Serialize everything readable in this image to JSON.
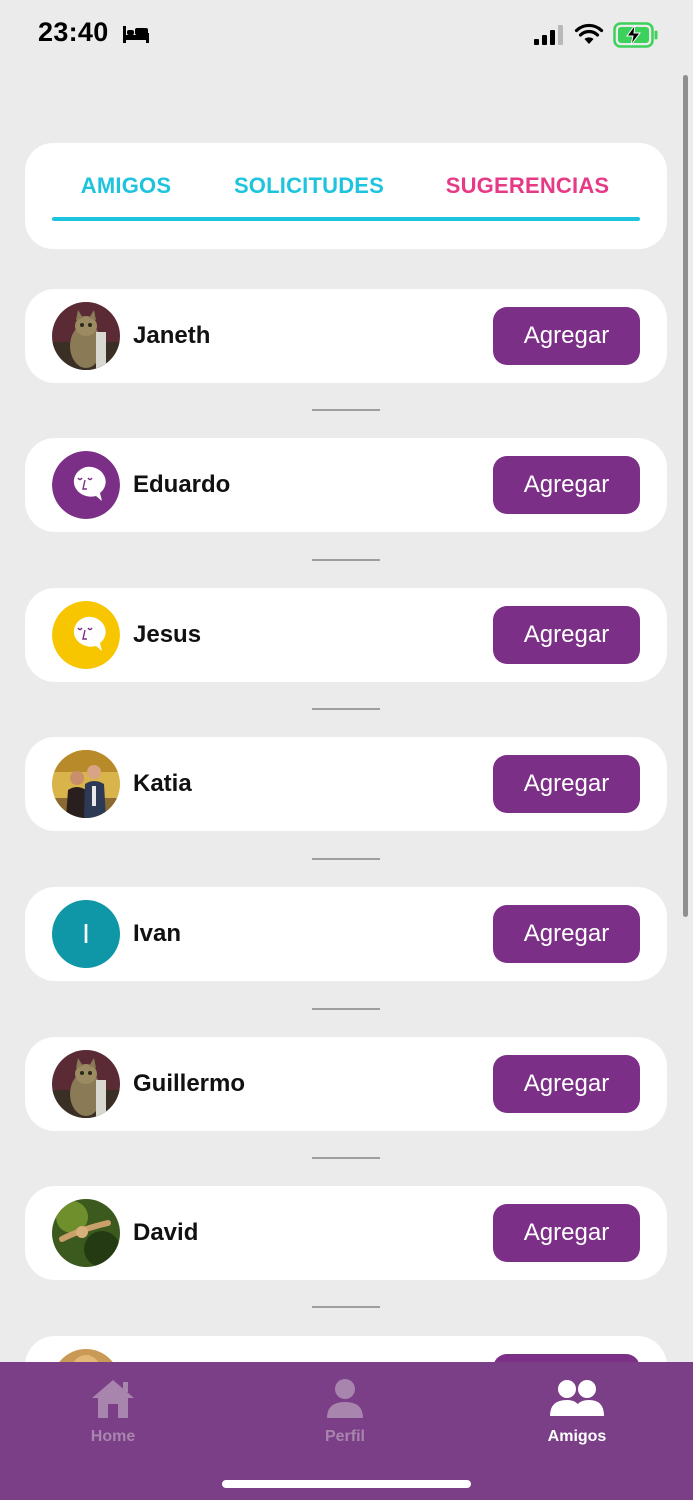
{
  "status_bar": {
    "time": "23:40",
    "icons": [
      "bed-icon",
      "cellular-signal-icon",
      "wifi-icon",
      "battery-charging-icon"
    ],
    "battery_color": "#3cd15b"
  },
  "tabs": [
    {
      "label": "AMIGOS",
      "color": "#1ec4dd"
    },
    {
      "label": "SOLICITUDES",
      "color": "#1ec4dd"
    },
    {
      "label": "SUGERENCIAS",
      "color": "#e73a86",
      "active": true
    }
  ],
  "colors": {
    "accent_cyan": "#1ec4dd",
    "accent_pink": "#e73a86",
    "button_purple": "#7b2f86",
    "nav_purple": "#7b3f88",
    "background": "#ebebeb"
  },
  "people": [
    {
      "name": "Janeth",
      "avatar": "cat-photo",
      "button": "Agregar"
    },
    {
      "name": "Eduardo",
      "avatar": "purple-chat-bubble",
      "button": "Agregar"
    },
    {
      "name": "Jesus",
      "avatar": "yellow-chat-bubble",
      "button": "Agregar"
    },
    {
      "name": "Katia",
      "avatar": "couple-photo",
      "button": "Agregar"
    },
    {
      "name": "Ivan",
      "avatar": "initial",
      "avatar_letter": "I",
      "button": "Agregar"
    },
    {
      "name": "Guillermo",
      "avatar": "cat-photo",
      "button": "Agregar"
    },
    {
      "name": "David",
      "avatar": "nature-photo",
      "button": "Agregar"
    }
  ],
  "bottom_nav": [
    {
      "label": "Home",
      "icon": "home-icon",
      "active": false
    },
    {
      "label": "Perfil",
      "icon": "person-icon",
      "active": false
    },
    {
      "label": "Amigos",
      "icon": "group-icon",
      "active": true
    }
  ]
}
